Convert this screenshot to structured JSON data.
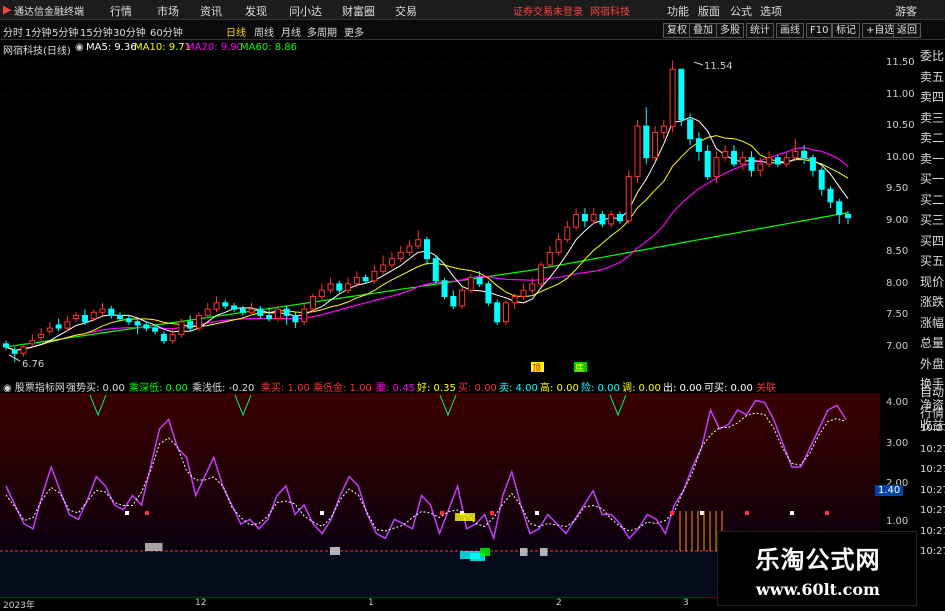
{
  "app": {
    "title": "通达信金融终端",
    "menus": [
      "行情",
      "市场",
      "资讯",
      "发现",
      "问小达",
      "财富圈",
      "交易"
    ],
    "status": "证券交易未登录",
    "account": "网宿科技",
    "right_menus": [
      "功能",
      "版面",
      "公式",
      "选项"
    ],
    "guest": "游客"
  },
  "periods": [
    "分时",
    "1分钟",
    "5分钟",
    "15分钟",
    "30分钟",
    "60分钟",
    "日线",
    "周线",
    "月线",
    "多周期",
    "更多"
  ],
  "active_period": "日线",
  "tools": [
    "复权",
    "叠加",
    "多股",
    "统计",
    "画线",
    "F10",
    "标记",
    "+自选",
    "返回"
  ],
  "info": {
    "stock": "网宿科技(日线)",
    "ma5": "MA5: 9.36",
    "ma10": "MA10: 9.71",
    "ma20": "MA20: 9.90",
    "ma60": "MA60: 8.86"
  },
  "price_ticks": [
    "11.50",
    "11.00",
    "10.50",
    "10.00",
    "9.50",
    "9.00",
    "8.50",
    "8.00",
    "7.50",
    "7.00"
  ],
  "annotations": {
    "high": "11.54",
    "low": "6.76"
  },
  "ind_header": {
    "name": "股票指标网",
    "items": [
      {
        "k": "强势买",
        "v": "0.00"
      },
      {
        "k": "乘深低",
        "v": "0.00"
      },
      {
        "k": "乘浅低",
        "v": "-0.20"
      },
      {
        "k": "乘买",
        "v": "1.00"
      },
      {
        "k": "乘低金",
        "v": "1.00"
      },
      {
        "k": "要",
        "v": "0.45"
      },
      {
        "k": "好",
        "v": "0.35"
      },
      {
        "k": "买",
        "v": "0.00"
      },
      {
        "k": "卖",
        "v": "4.00"
      },
      {
        "k": "高",
        "v": "0.00"
      },
      {
        "k": "险",
        "v": "0.00"
      },
      {
        "k": "调",
        "v": "0.00"
      },
      {
        "k": "出",
        "v": "0.00"
      },
      {
        "k": "可买",
        "v": "0.00"
      },
      {
        "k": "关联",
        "v": ""
      }
    ]
  },
  "ind_ticks": [
    "4.00",
    "3.00",
    "2.00",
    "1.00"
  ],
  "cur_val": "1.40",
  "side_items": [
    "委比",
    "卖五",
    "卖四",
    "卖三",
    "卖二",
    "卖一",
    "买一",
    "买二",
    "买三",
    "买四",
    "买五",
    "现价",
    "涨跌",
    "涨幅",
    "总量",
    "外盘",
    "换手",
    "净资",
    "收益",
    "自动",
    "行情",
    "10:27",
    "10:27",
    "10:27",
    "10:27",
    "10:27",
    "10:27",
    "10:27"
  ],
  "time_labels": [
    "2023年",
    "12",
    "1",
    "2",
    "3"
  ],
  "signals": [
    "顶",
    "底"
  ],
  "watermark": {
    "name": "乐淘公式网",
    "url": "www.60lt.com"
  },
  "colors": {
    "up": "#ff3232",
    "down": "#00ffff",
    "ma5": "#ffffff",
    "ma10": "#ffff00",
    "ma20": "#ff00ff",
    "ma60": "#00ff00"
  },
  "chart_data": {
    "type": "candlestick",
    "ohlc": []
  }
}
